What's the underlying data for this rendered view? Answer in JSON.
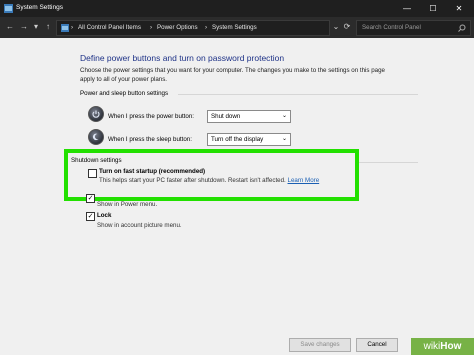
{
  "window": {
    "title": "System Settings",
    "minimize": "—",
    "maximize": "☐",
    "close": "✕"
  },
  "nav": {
    "back": "←",
    "forward": "→",
    "recent": "▾",
    "up": "↑",
    "refresh": "⟳",
    "dropdown": "⌄"
  },
  "breadcrumb": [
    "All Control Panel Items",
    "Power Options",
    "System Settings"
  ],
  "breadcrumb_separator": "›",
  "search": {
    "placeholder": "Search Control Panel"
  },
  "page": {
    "heading": "Define power buttons and turn on password protection",
    "description": "Choose the power settings that you want for your computer. The changes you make to the settings on this page apply to all of your power plans."
  },
  "power_sleep": {
    "group_label": "Power and sleep button settings",
    "power_button": {
      "label": "When I press the power button:",
      "value": "Shut down"
    },
    "sleep_button": {
      "label": "When I press the sleep button:",
      "value": "Turn off the display"
    }
  },
  "shutdown": {
    "group_label": "Shutdown settings",
    "fast_startup": {
      "label": "Turn on fast startup (recommended)",
      "description": "This helps start your PC faster after shutdown. Restart isn't affected.",
      "link": "Learn More",
      "checked": false
    },
    "sleep_item": {
      "checkmark": "✓",
      "description": "Show in Power menu."
    },
    "lock": {
      "label": "Lock",
      "description": "Show in account picture menu.",
      "checked": true,
      "checkmark": "✓"
    }
  },
  "footer": {
    "save": "Save changes",
    "cancel": "Cancel"
  },
  "watermark": {
    "wiki": "wiki",
    "how": "How"
  },
  "colors": {
    "highlight": "#22e000",
    "heading": "#1e3287",
    "link": "#1a5fb4"
  }
}
